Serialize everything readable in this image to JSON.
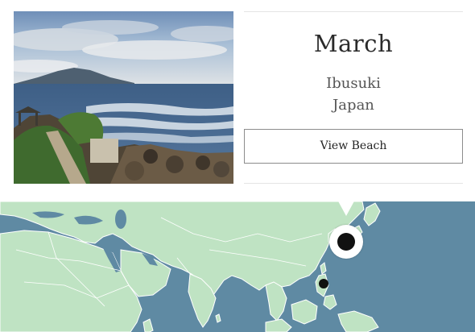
{
  "destination": {
    "month": "March",
    "city": "Ibusuki",
    "country": "Japan",
    "view_button_label": "View Beach"
  },
  "map": {
    "ocean_color": "#5f8aa3",
    "land_color": "#bfe3c3",
    "border_color": "#ffffff",
    "markers": [
      "selected-location-marker",
      "location-marker"
    ]
  }
}
